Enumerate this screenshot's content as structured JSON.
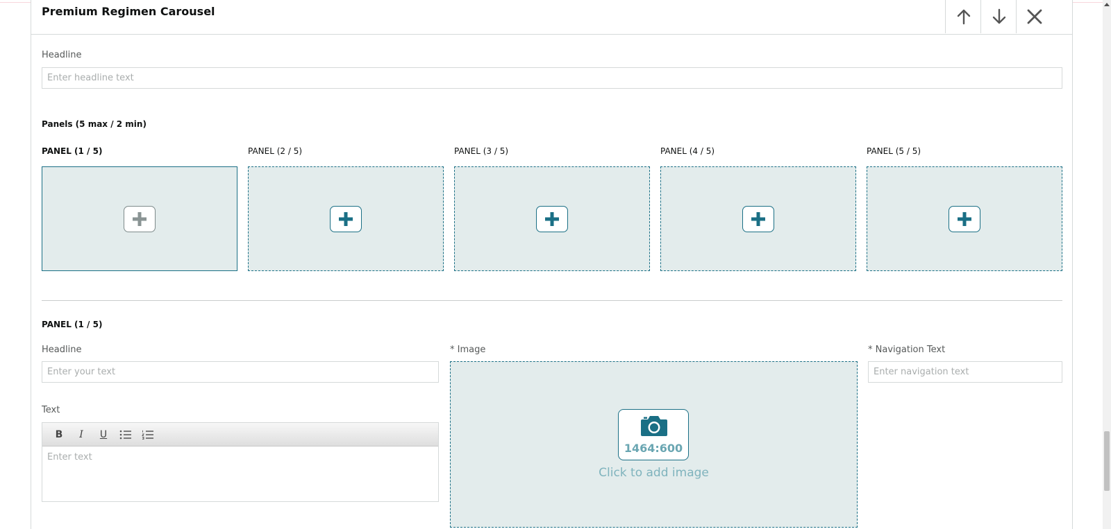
{
  "module": {
    "title": "Premium Regimen Carousel",
    "move_up_icon": "arrow-up-icon",
    "move_down_icon": "arrow-down-icon",
    "remove_icon": "close-icon"
  },
  "headline": {
    "label": "Headline",
    "placeholder": "Enter headline text"
  },
  "panels": {
    "heading": "Panels (5 max / 2 min)",
    "items": [
      {
        "label": "PANEL (1 / 5)",
        "selected": true
      },
      {
        "label": "PANEL (2 / 5)",
        "selected": false
      },
      {
        "label": "PANEL (3 / 5)",
        "selected": false
      },
      {
        "label": "PANEL (4 / 5)",
        "selected": false
      },
      {
        "label": "PANEL (5 / 5)",
        "selected": false
      }
    ],
    "add_icon": "plus-icon"
  },
  "panel_editor": {
    "title": "PANEL (1 / 5)",
    "headline_label": "Headline",
    "headline_placeholder": "Enter your text",
    "text_label": "Text",
    "text_placeholder": "Enter text",
    "toolbar": {
      "bold": "B",
      "italic": "I",
      "underline": "U",
      "bullet_list_icon": "bulleted-list-icon",
      "numbered_list_icon": "numbered-list-icon"
    },
    "image_label": "* Image",
    "image_ratio": "1464:600",
    "image_cta": "Click to add image",
    "image_icon": "camera-icon",
    "nav_label": "* Navigation Text",
    "nav_placeholder": "Enter navigation text"
  },
  "colors": {
    "accent": "#1a6f85",
    "panel_bg": "#e3ecec",
    "muted_text": "#565959"
  }
}
